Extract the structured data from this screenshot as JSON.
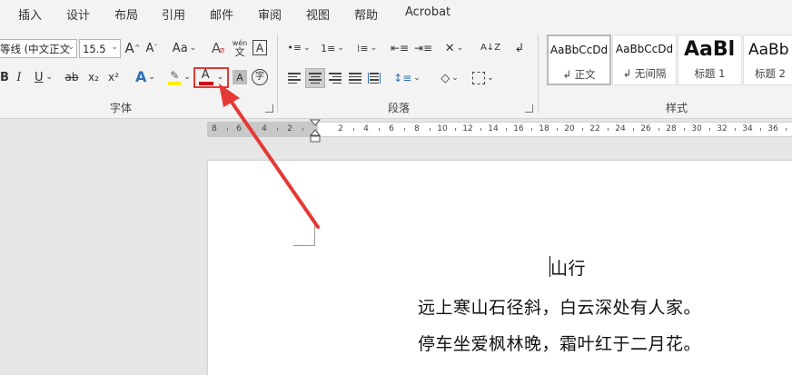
{
  "tabs": [
    "插入",
    "设计",
    "布局",
    "引用",
    "邮件",
    "审阅",
    "视图",
    "帮助",
    "Acrobat"
  ],
  "font": {
    "name_value": "等线 (中文正文",
    "size_value": "15.5",
    "grow_label": "A",
    "shrink_label": "A",
    "case_label": "Aa",
    "phonetic_top": "wén",
    "phonetic_bottom": "文",
    "border_char_label": "A",
    "subscript_label": "x₂",
    "superscript_label": "x²",
    "font_color_label": "A",
    "font_color": "#d0021b",
    "char_shading_label": "A",
    "enclose_label": "字",
    "group_label": "字体"
  },
  "paragraph": {
    "group_label": "段落"
  },
  "styles": {
    "group_label": "样式",
    "items": [
      {
        "sample": "AaBbCcDd",
        "name": "↲ 正文"
      },
      {
        "sample": "AaBbCcDd",
        "name": "↲ 无间隔"
      },
      {
        "sample": "AaBl",
        "name": "标题 1"
      },
      {
        "sample": "AaBb",
        "name": "标题 2"
      }
    ]
  },
  "ruler_numbers": [
    "8",
    "6",
    "4",
    "2",
    "2",
    "2",
    "4",
    "6",
    "8",
    "10",
    "12",
    "14",
    "16",
    "18",
    "20",
    "22",
    "24",
    "26",
    "28",
    "30",
    "32",
    "34",
    "36"
  ],
  "document": {
    "title": "山行",
    "line1": "远上寒山石径斜，白云深处有人家。",
    "line2": "停车坐爱枫林晚，霜叶红于二月花。"
  },
  "annotation": {
    "color": "#e53935"
  }
}
